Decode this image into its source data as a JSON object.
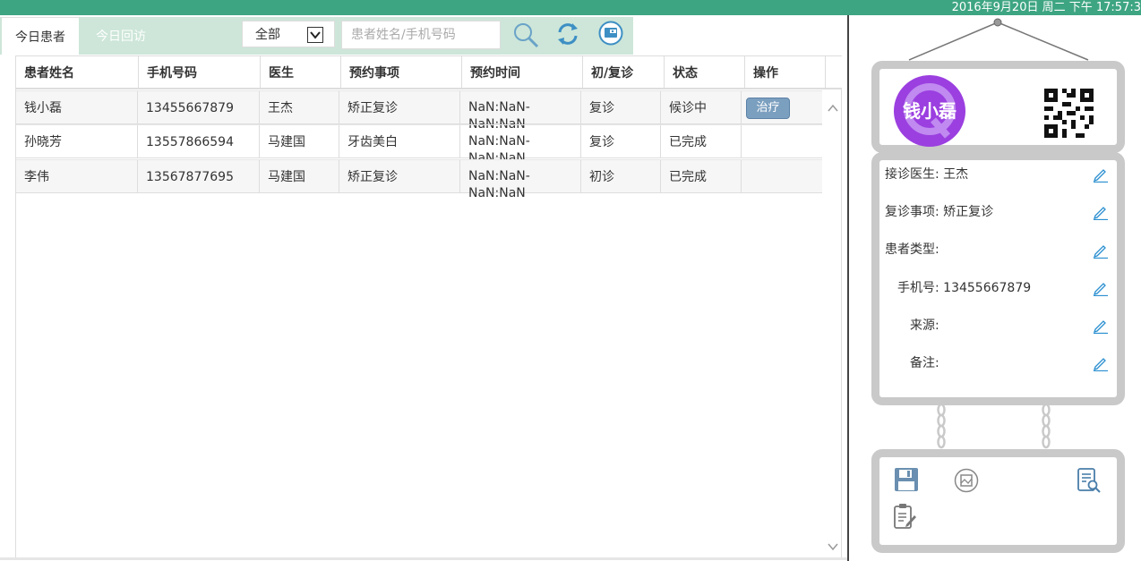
{
  "header": {
    "clock": "2016年9月20日 周二 下午 17:57:3"
  },
  "tabs": [
    {
      "label": "今日患者"
    },
    {
      "label": "今日回访"
    }
  ],
  "filter": {
    "selected": "全部"
  },
  "search": {
    "placeholder": "患者姓名/手机号码"
  },
  "table": {
    "headers": [
      "患者姓名",
      "手机号码",
      "医生",
      "预约事项",
      "预约时间",
      "初/复诊",
      "状态",
      "操作"
    ],
    "rows": [
      {
        "name": "钱小磊",
        "phone": "13455667879",
        "doctor": "王杰",
        "item": "矫正复诊",
        "time": "NaN:NaN-NaN:NaN",
        "visit": "复诊",
        "status": "候诊中",
        "action": "治疗"
      },
      {
        "name": "孙晓芳",
        "phone": "13557866594",
        "doctor": "马建国",
        "item": "牙齿美白",
        "time": "NaN:NaN-NaN:NaN",
        "visit": "复诊",
        "status": "已完成",
        "action": ""
      },
      {
        "name": "李伟",
        "phone": "13567877695",
        "doctor": "马建国",
        "item": "矫正复诊",
        "time": "NaN:NaN-NaN:NaN",
        "visit": "初诊",
        "status": "已完成",
        "action": ""
      }
    ]
  },
  "patient": {
    "name": "钱小磊",
    "fields": [
      {
        "label": "接诊医生:",
        "value": "王杰"
      },
      {
        "label": "复诊事项:",
        "value": "矫正复诊"
      },
      {
        "label": "患者类型:",
        "value": ""
      },
      {
        "label": "手机号:",
        "value": "13455667879"
      },
      {
        "label": "来源:",
        "value": ""
      },
      {
        "label": "备注:",
        "value": ""
      }
    ]
  },
  "colors": {
    "topbar": "#3ea582",
    "tabbar": "#cde6d9",
    "avatar": "#9b3fe0",
    "button": "#7b9fbf"
  }
}
